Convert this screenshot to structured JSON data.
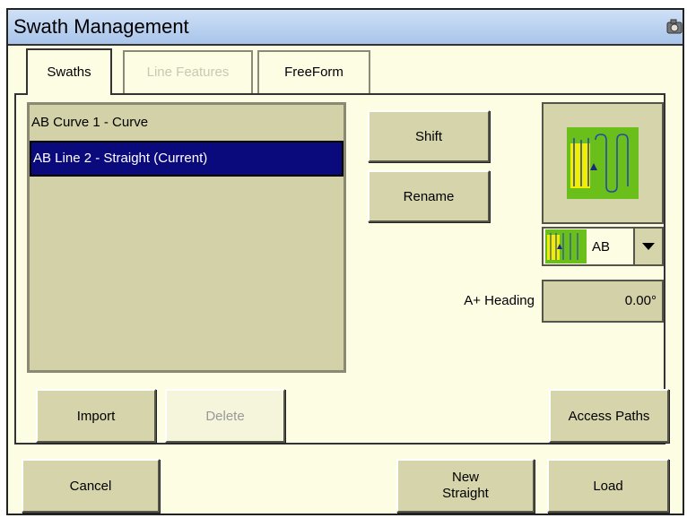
{
  "window": {
    "title": "Swath Management"
  },
  "tabs": [
    {
      "label": "Swaths",
      "state": "active"
    },
    {
      "label": "Line Features",
      "state": "disabled"
    },
    {
      "label": "FreeForm",
      "state": "normal"
    }
  ],
  "swath_list": {
    "items": [
      {
        "label": "AB Curve 1 - Curve",
        "selected": false
      },
      {
        "label": "AB Line 2 - Straight (Current)",
        "selected": true
      }
    ]
  },
  "actions": {
    "shift_label": "Shift",
    "rename_label": "Rename",
    "import_label": "Import",
    "delete_label": "Delete",
    "access_paths_label": "Access Paths"
  },
  "pattern": {
    "selected_value": "AB"
  },
  "heading": {
    "label": "A+ Heading",
    "value": "0.00°"
  },
  "footer": {
    "cancel_label": "Cancel",
    "new_straight_line1": "New",
    "new_straight_line2": "Straight",
    "load_label": "Load"
  },
  "colors": {
    "background": "#fdfde3",
    "titlebar": "#b9d0f0",
    "button": "#d6d4ab",
    "list_bg": "#d3d1a8",
    "selection": "#0a0a7c",
    "pattern_green": "#6bbf1a",
    "pattern_yellow": "#f2ee00",
    "pattern_blue": "#2a4aa8"
  },
  "icons": [
    "camera-icon",
    "ab-pattern-icon",
    "dropdown-arrow-icon"
  ]
}
